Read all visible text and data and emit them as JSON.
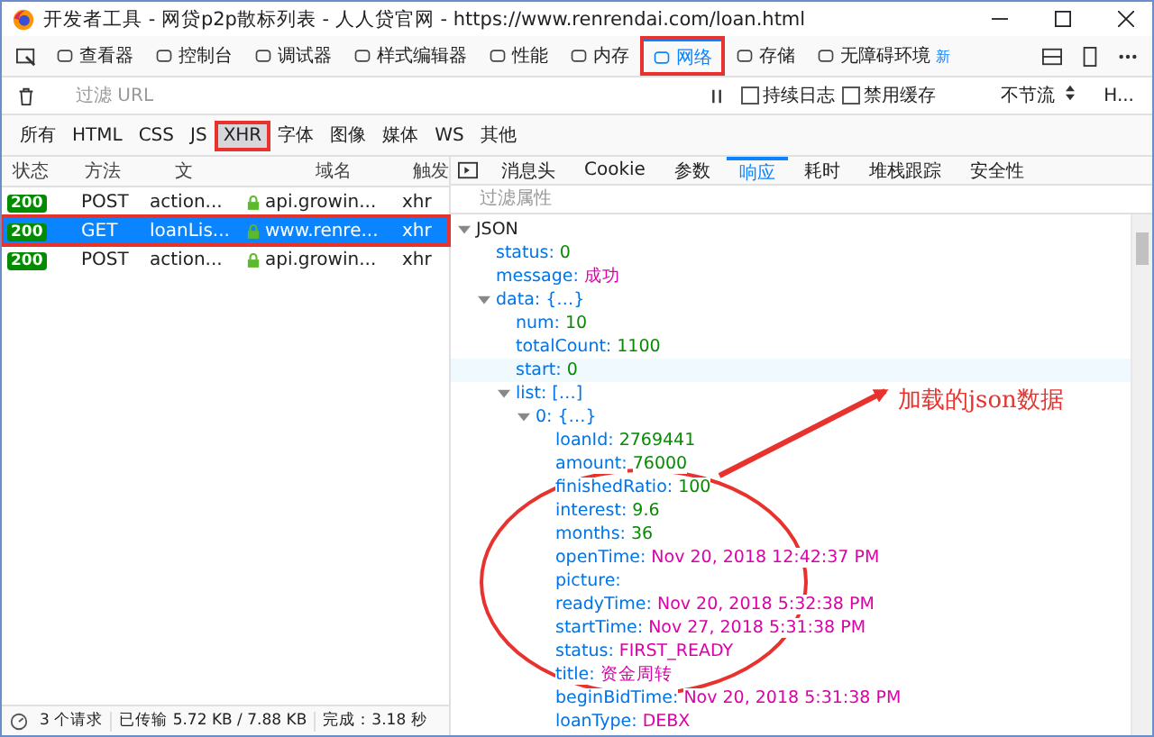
{
  "window": {
    "title": "开发者工具 - 网贷p2p散标列表 - 人人贷官网 - https://www.renrendai.com/loan.html"
  },
  "toolbar_tabs": [
    {
      "label": "查看器",
      "selected": false,
      "annotated": false
    },
    {
      "label": "控制台",
      "selected": false,
      "annotated": false
    },
    {
      "label": "调试器",
      "selected": false,
      "annotated": false
    },
    {
      "label": "样式编辑器",
      "selected": false,
      "annotated": false
    },
    {
      "label": "性能",
      "selected": false,
      "annotated": false
    },
    {
      "label": "内存",
      "selected": false,
      "annotated": false
    },
    {
      "label": "网络",
      "selected": true,
      "annotated": true
    },
    {
      "label": "存储",
      "selected": false,
      "annotated": false
    },
    {
      "label": "无障碍环境",
      "selected": false,
      "annotated": false,
      "badge": "新"
    }
  ],
  "filter": {
    "placeholder": "过滤 URL"
  },
  "options": [
    {
      "label": "持续日志",
      "checked": false
    },
    {
      "label": "禁用缓存",
      "checked": false
    }
  ],
  "throttle": "不节流",
  "har_menu": "H...",
  "type_filters": [
    {
      "label": "所有",
      "selected": false,
      "annotated": false
    },
    {
      "label": "HTML",
      "selected": false,
      "annotated": false
    },
    {
      "label": "CSS",
      "selected": false,
      "annotated": false
    },
    {
      "label": "JS",
      "selected": false,
      "annotated": false
    },
    {
      "label": "XHR",
      "selected": true,
      "annotated": true
    },
    {
      "label": "字体",
      "selected": false,
      "annotated": false
    },
    {
      "label": "图像",
      "selected": false,
      "annotated": false
    },
    {
      "label": "媒体",
      "selected": false,
      "annotated": false
    },
    {
      "label": "WS",
      "selected": false,
      "annotated": false
    },
    {
      "label": "其他",
      "selected": false,
      "annotated": false
    }
  ],
  "columns": [
    "状态",
    "方法",
    "文",
    "域名",
    "触发"
  ],
  "requests": [
    {
      "status": "200",
      "method": "POST",
      "file": "action...",
      "domain": "api.growin...",
      "cause": "xhr",
      "selected": false,
      "annotated": false
    },
    {
      "status": "200",
      "method": "GET",
      "file": "loanLis...",
      "domain": "www.renre...",
      "cause": "xhr",
      "selected": true,
      "annotated": true
    },
    {
      "status": "200",
      "method": "POST",
      "file": "action...",
      "domain": "api.growin...",
      "cause": "xhr",
      "selected": false,
      "annotated": false
    }
  ],
  "status_bar": {
    "requests": "3 个请求",
    "transferred": "已传输 5.72 KB / 7.88 KB",
    "finish": "完成：3.18 秒"
  },
  "detail_tabs": [
    {
      "label": "消息头",
      "selected": false
    },
    {
      "label": "Cookie",
      "selected": false
    },
    {
      "label": "参数",
      "selected": false
    },
    {
      "label": "响应",
      "selected": true
    },
    {
      "label": "耗时",
      "selected": false
    },
    {
      "label": "堆栈跟踪",
      "selected": false
    },
    {
      "label": "安全性",
      "selected": false
    }
  ],
  "response": {
    "filter": {
      "placeholder": "过滤属性"
    },
    "tree": {
      "key": "JSON",
      "kind": "root",
      "expanded": true,
      "children": [
        {
          "key": "status:",
          "kind": "number",
          "value": "0"
        },
        {
          "key": "message:",
          "kind": "string",
          "value": "成功"
        },
        {
          "key": "data:",
          "kind": "object",
          "value": "{…}",
          "expanded": true,
          "children": [
            {
              "key": "num:",
              "kind": "number",
              "value": "10"
            },
            {
              "key": "totalCount:",
              "kind": "number",
              "value": "1100"
            },
            {
              "key": "start:",
              "kind": "number",
              "value": "0",
              "hovered": true
            },
            {
              "key": "list:",
              "kind": "object",
              "value": "[…]",
              "expanded": true,
              "children": [
                {
                  "key": "0:",
                  "kind": "object",
                  "value": "{…}",
                  "expanded": true,
                  "children": [
                    {
                      "key": "loanId:",
                      "kind": "number",
                      "value": "2769441"
                    },
                    {
                      "key": "amount:",
                      "kind": "number",
                      "value": "76000"
                    },
                    {
                      "key": "finishedRatio:",
                      "kind": "number",
                      "value": "100"
                    },
                    {
                      "key": "interest:",
                      "kind": "number",
                      "value": "9.6"
                    },
                    {
                      "key": "months:",
                      "kind": "number",
                      "value": "36"
                    },
                    {
                      "key": "openTime:",
                      "kind": "string",
                      "value": "Nov 20, 2018 12:42:37 PM"
                    },
                    {
                      "key": "picture:",
                      "kind": "string"
                    },
                    {
                      "key": "readyTime:",
                      "kind": "string",
                      "value": "Nov 20, 2018 5:32:38 PM"
                    },
                    {
                      "key": "startTime:",
                      "kind": "string",
                      "value": "Nov 27, 2018 5:31:38 PM"
                    },
                    {
                      "key": "status:",
                      "kind": "string",
                      "value": "FIRST_READY"
                    },
                    {
                      "key": "title:",
                      "kind": "string",
                      "value": "资金周转"
                    },
                    {
                      "key": "beginBidTime:",
                      "kind": "string",
                      "value": "Nov 20, 2018 5:31:38 PM"
                    },
                    {
                      "key": "loanType:",
                      "kind": "string",
                      "value": "DEBX"
                    }
                  ]
                }
              ]
            }
          ]
        }
      ]
    }
  },
  "annotation": {
    "text": "加载的json数据"
  }
}
